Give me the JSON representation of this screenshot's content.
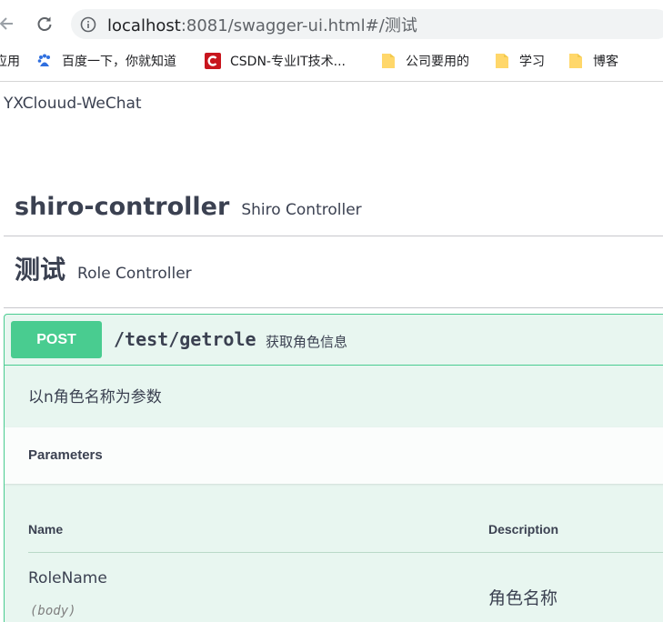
{
  "browser": {
    "url_host": "localhost",
    "url_rest": ":8081/swagger-ui.html#/测试",
    "icons": {
      "back": "arrow-left-icon",
      "reload": "reload-icon",
      "info": "info-icon"
    },
    "bookmarks": [
      {
        "label": "应用",
        "icon": "apps-icon"
      },
      {
        "label": "百度一下，你就知道",
        "icon": "baidu-paw-icon"
      },
      {
        "label": "CSDN-专业IT技术...",
        "icon": "csdn-icon"
      },
      {
        "label": "公司要用的",
        "icon": "folder-icon"
      },
      {
        "label": "学习",
        "icon": "folder-icon"
      },
      {
        "label": "博客",
        "icon": "folder-icon"
      }
    ]
  },
  "page": {
    "app_title": "YXClouud-WeChat",
    "tags": [
      {
        "name": "shiro-controller",
        "description": "Shiro Controller"
      },
      {
        "name": "测试",
        "description": "Role Controller"
      }
    ],
    "operation": {
      "method": "POST",
      "path": "/test/getrole",
      "summary": "获取角色信息",
      "description": "以n角色名称为参数",
      "parameters_title": "Parameters",
      "columns": [
        "Name",
        "Description"
      ],
      "params": [
        {
          "name": "RoleName",
          "in": "(body)",
          "description": "角色名称"
        }
      ]
    }
  },
  "colors": {
    "post": "#49cc90",
    "post_bg": "#e8f6f0",
    "text": "#3b4151"
  }
}
